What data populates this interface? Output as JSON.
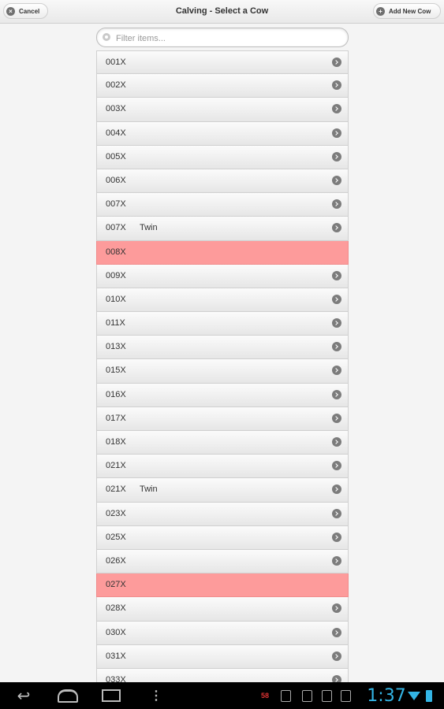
{
  "header": {
    "title": "Calving - Select a Cow",
    "cancel_label": "Cancel",
    "add_label": "Add New Cow"
  },
  "filter": {
    "placeholder": "Filter items..."
  },
  "list": {
    "items": [
      {
        "id": "001X",
        "note": "",
        "highlight": false
      },
      {
        "id": "002X",
        "note": "",
        "highlight": false
      },
      {
        "id": "003X",
        "note": "",
        "highlight": false
      },
      {
        "id": "004X",
        "note": "",
        "highlight": false
      },
      {
        "id": "005X",
        "note": "",
        "highlight": false
      },
      {
        "id": "006X",
        "note": "",
        "highlight": false
      },
      {
        "id": "007X",
        "note": "",
        "highlight": false
      },
      {
        "id": "007X",
        "note": "Twin",
        "highlight": false
      },
      {
        "id": "008X",
        "note": "",
        "highlight": true
      },
      {
        "id": "009X",
        "note": "",
        "highlight": false
      },
      {
        "id": "010X",
        "note": "",
        "highlight": false
      },
      {
        "id": "011X",
        "note": "",
        "highlight": false
      },
      {
        "id": "013X",
        "note": "",
        "highlight": false
      },
      {
        "id": "015X",
        "note": "",
        "highlight": false
      },
      {
        "id": "016X",
        "note": "",
        "highlight": false
      },
      {
        "id": "017X",
        "note": "",
        "highlight": false
      },
      {
        "id": "018X",
        "note": "",
        "highlight": false
      },
      {
        "id": "021X",
        "note": "",
        "highlight": false
      },
      {
        "id": "021X",
        "note": "Twin",
        "highlight": false
      },
      {
        "id": "023X",
        "note": "",
        "highlight": false
      },
      {
        "id": "025X",
        "note": "",
        "highlight": false
      },
      {
        "id": "026X",
        "note": "",
        "highlight": false
      },
      {
        "id": "027X",
        "note": "",
        "highlight": true
      },
      {
        "id": "028X",
        "note": "",
        "highlight": false
      },
      {
        "id": "030X",
        "note": "",
        "highlight": false
      },
      {
        "id": "031X",
        "note": "",
        "highlight": false
      },
      {
        "id": "033X",
        "note": "",
        "highlight": false
      }
    ]
  },
  "system_bar": {
    "time": "1:37",
    "notification_badge": "58",
    "icons": [
      "back-icon",
      "home-icon",
      "recent-apps-icon",
      "menu-icon",
      "wifi-icon",
      "battery-icon"
    ],
    "accent_color": "#33b5e5"
  },
  "colors": {
    "highlight_row": "#fd9b9b"
  }
}
